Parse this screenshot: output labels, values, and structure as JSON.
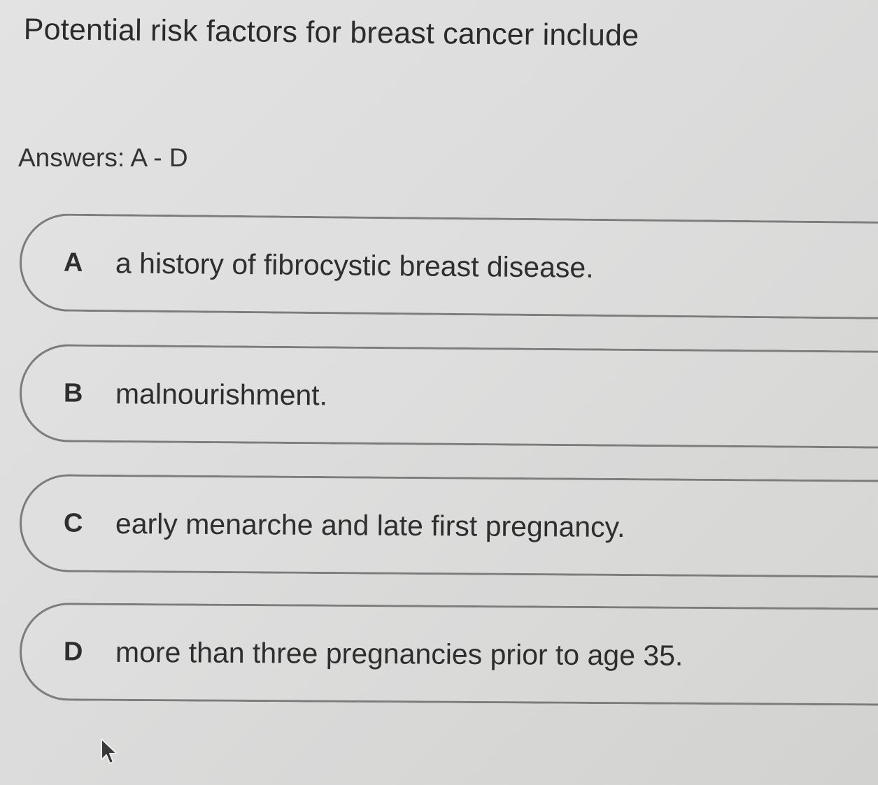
{
  "question": {
    "text": "Potential risk factors for breast cancer include"
  },
  "answers_hint": "Answers: A - D",
  "options": [
    {
      "letter": "A",
      "text": "a history of fibrocystic breast disease."
    },
    {
      "letter": "B",
      "text": "malnourishment."
    },
    {
      "letter": "C",
      "text": "early menarche and late first pregnancy."
    },
    {
      "letter": "D",
      "text": "more than three pregnancies prior to age 35."
    }
  ],
  "icons": {
    "cursor": "mouse-pointer-icon"
  }
}
